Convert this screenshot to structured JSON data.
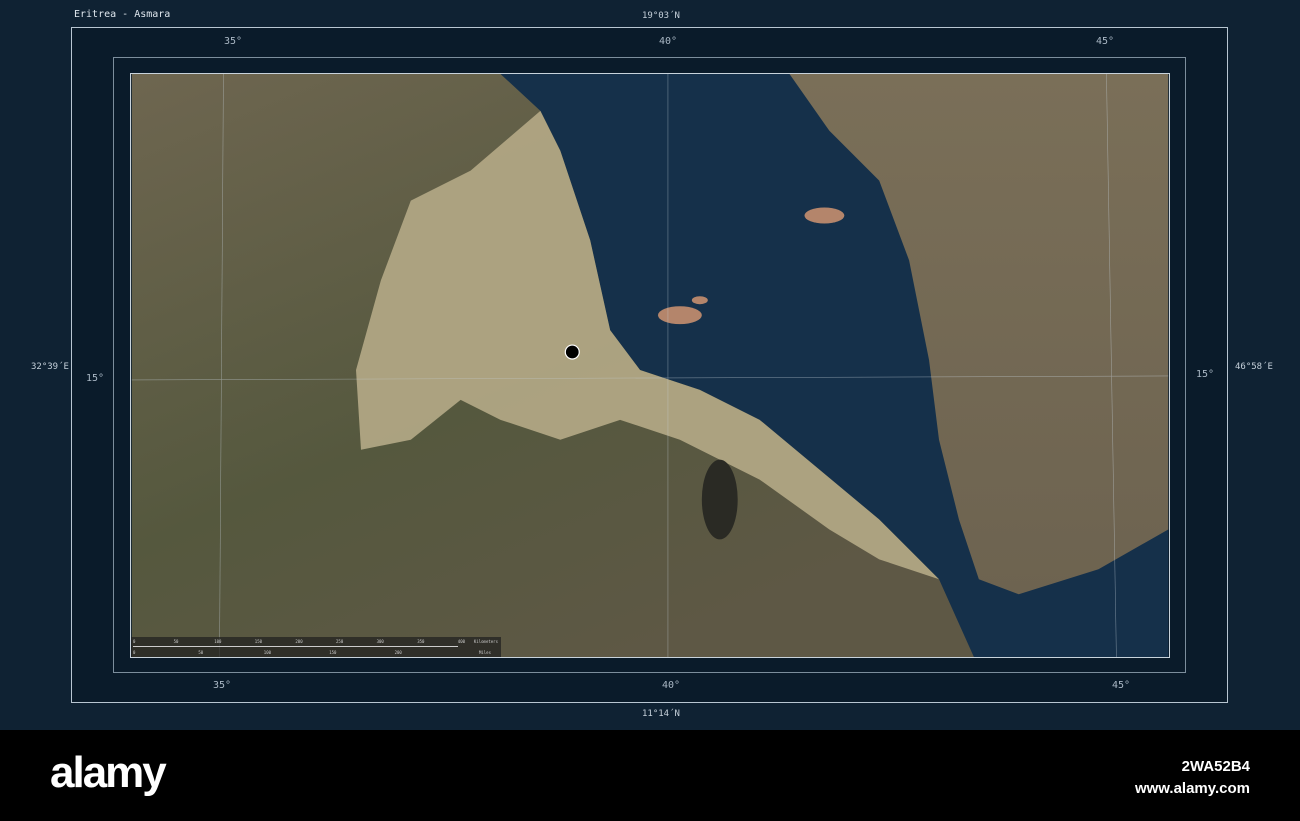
{
  "title": "Eritrea - Asmara",
  "bounds": {
    "north": "19°03´N",
    "south": "11°14´N",
    "west": "32°39´E",
    "east": "46°58´E"
  },
  "lon_ticks": [
    "35°",
    "40°",
    "45°"
  ],
  "lat_ticks": [
    "15°"
  ],
  "marker": {
    "name": "Asmara",
    "color": "#000000"
  },
  "scale_bar": {
    "km_ticks": [
      "0",
      "50",
      "100",
      "150",
      "200",
      "250",
      "300",
      "350",
      "400"
    ],
    "km_label": "Kilometers",
    "mi_ticks": [
      "0",
      "50",
      "100",
      "150",
      "200"
    ],
    "mi_label": "Miles"
  },
  "banner": {
    "logo": "alamy",
    "image_id": "2WA52B4",
    "url": "www.alamy.com"
  },
  "colors": {
    "sea": "#15304a",
    "land": "#6b6650",
    "highlight": "#b9ad8c",
    "frame": "#0a1b2a"
  }
}
